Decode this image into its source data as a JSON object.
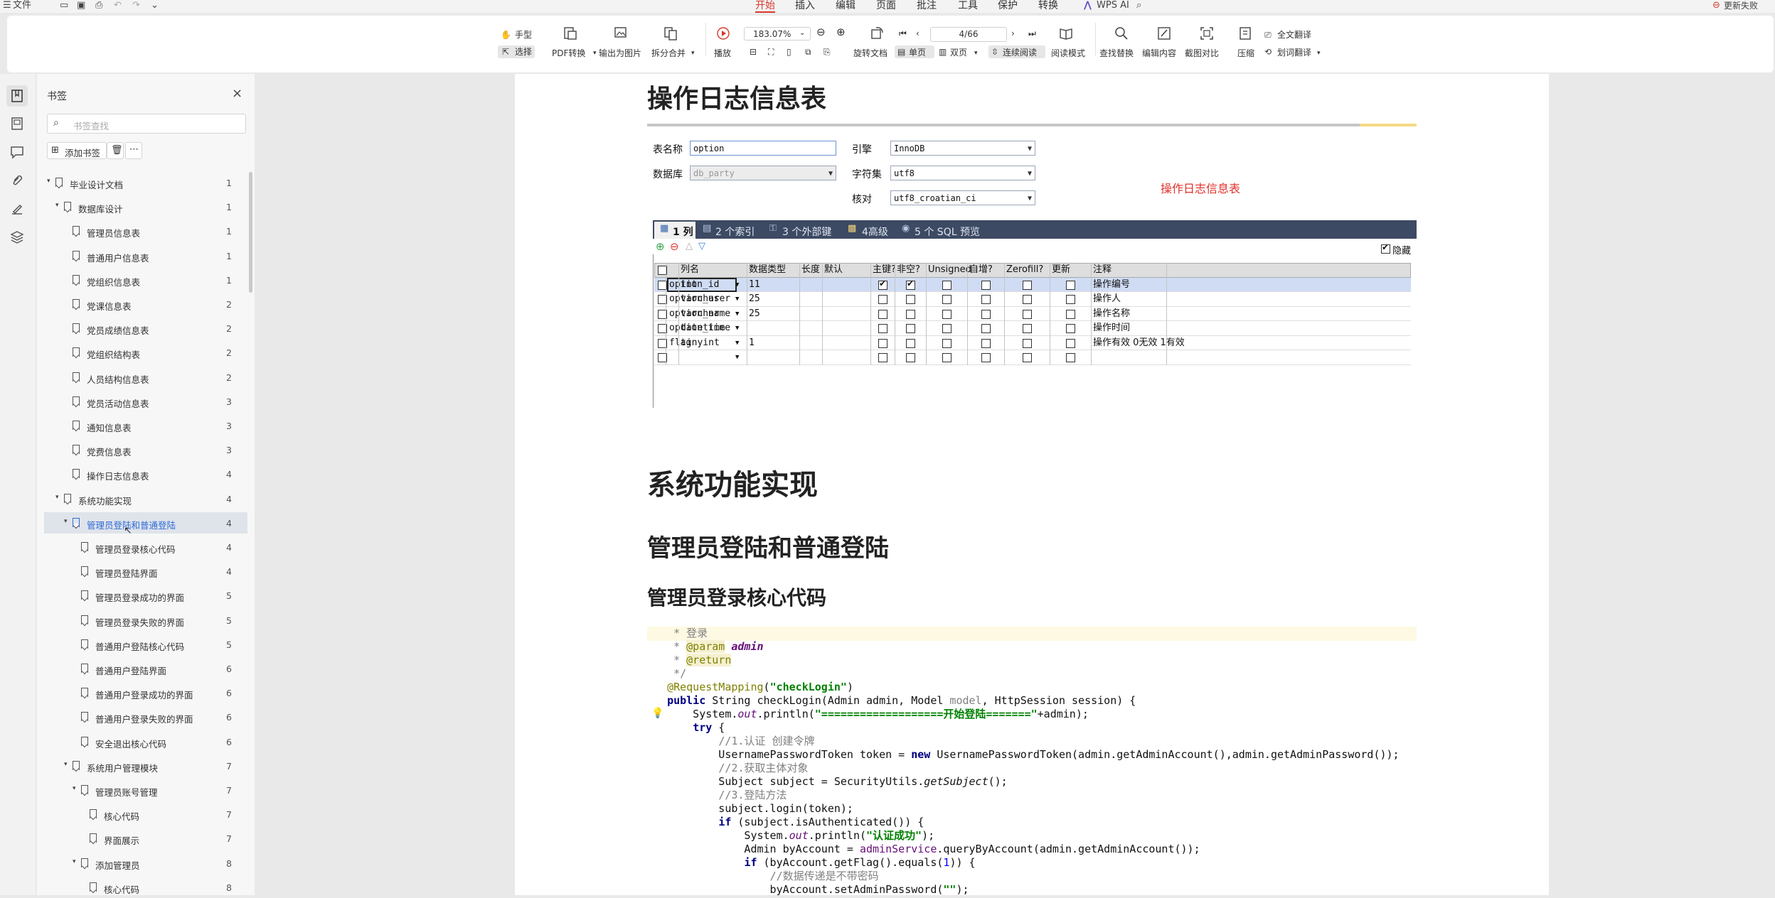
{
  "menubar": {
    "app_menu": "文件",
    "tabs": [
      "开始",
      "插入",
      "编辑",
      "页面",
      "批注",
      "工具",
      "保护",
      "转换"
    ],
    "active_tab": "开始",
    "wps_ai": "WPS AI",
    "status": "更新失败"
  },
  "toolbar": {
    "hand": "手型",
    "select": "选择",
    "pdf_convert": "PDF转换",
    "export_image": "输出为图片",
    "split_merge": "拆分合并",
    "play": "播放",
    "zoom": "183.07%",
    "page_indicator": "4/66",
    "rotate": "旋转文档",
    "single_page": "单页",
    "double_page": "双页",
    "continuous": "连续阅读",
    "read_mode": "阅读模式",
    "find_replace": "查找替换",
    "edit_content": "编辑内容",
    "screenshot_compare": "截图对比",
    "compress": "压缩",
    "full_translate": "全文翻译",
    "word_translate": "划词翻译"
  },
  "bookmarks": {
    "title": "书签",
    "search_placeholder": "书签查找",
    "add_label": "添加书签",
    "items": [
      {
        "label": "毕业设计文档",
        "page": "1"
      },
      {
        "label": "数据库设计",
        "page": "1"
      },
      {
        "label": "管理员信息表",
        "page": "1"
      },
      {
        "label": "普通用户信息表",
        "page": "1"
      },
      {
        "label": "党组织信息表",
        "page": "1"
      },
      {
        "label": "党课信息表",
        "page": "2"
      },
      {
        "label": "党员成绩信息表",
        "page": "2"
      },
      {
        "label": "党组织结构表",
        "page": "2"
      },
      {
        "label": "人员结构信息表",
        "page": "2"
      },
      {
        "label": "党员活动信息表",
        "page": "3"
      },
      {
        "label": "通知信息表",
        "page": "3"
      },
      {
        "label": "党费信息表",
        "page": "3"
      },
      {
        "label": "操作日志信息表",
        "page": "4"
      },
      {
        "label": "系统功能实现",
        "page": "4"
      },
      {
        "label": "管理员登陆和普通登陆",
        "page": "4"
      },
      {
        "label": "管理员登录核心代码",
        "page": "4"
      },
      {
        "label": "管理员登陆界面",
        "page": "4"
      },
      {
        "label": "管理员登录成功的界面",
        "page": "5"
      },
      {
        "label": "管理员登录失败的界面",
        "page": "5"
      },
      {
        "label": "普通用户登陆核心代码",
        "page": "5"
      },
      {
        "label": "普通用户登陆界面",
        "page": "6"
      },
      {
        "label": "普通用户登录成功的界面",
        "page": "6"
      },
      {
        "label": "普通用户登录失败的界面",
        "page": "6"
      },
      {
        "label": "安全退出核心代码",
        "page": "6"
      },
      {
        "label": "系统用户管理模块",
        "page": "7"
      },
      {
        "label": "管理员账号管理",
        "page": "7"
      },
      {
        "label": "核心代码",
        "page": "7"
      },
      {
        "label": "界面展示",
        "page": "7"
      },
      {
        "label": "添加管理员",
        "page": "8"
      },
      {
        "label": "核心代码",
        "page": "8"
      }
    ]
  },
  "document": {
    "heading_log_table": "操作日志信息表",
    "form": {
      "table_name_label": "表名称",
      "table_name_value": "option",
      "database_label": "数据库",
      "database_value": "db_party",
      "engine_label": "引擎",
      "engine_value": "InnoDB",
      "charset_label": "字符集",
      "charset_value": "utf8",
      "collation_label": "核对",
      "collation_value": "utf8_croatian_ci",
      "caption": "操作日志信息表"
    },
    "grid": {
      "tabs": [
        "1 列",
        "2 个索引",
        "3 个外部键",
        "4高级",
        "5 个 SQL 预览"
      ],
      "hide_label": "隐藏",
      "headers": [
        "列名",
        "数据类型",
        "长度",
        "默认",
        "主键?",
        "非空?",
        "Unsigned",
        "自增?",
        "Zerofill?",
        "更新",
        "注释"
      ],
      "rows": [
        {
          "name": "option_id",
          "type": "int",
          "length": "11",
          "pk": true,
          "nn": true,
          "comment": "操作编号"
        },
        {
          "name": "option_user",
          "type": "varchar",
          "length": "25",
          "pk": false,
          "nn": false,
          "comment": "操作人"
        },
        {
          "name": "option_name",
          "type": "varchar",
          "length": "25",
          "pk": false,
          "nn": false,
          "comment": "操作名称"
        },
        {
          "name": "option_time",
          "type": "datetime",
          "length": "",
          "pk": false,
          "nn": false,
          "comment": "操作时间"
        },
        {
          "name": "flag",
          "type": "tinyint",
          "length": "1",
          "pk": false,
          "nn": false,
          "comment": "操作有效 0无效 1有效"
        },
        {
          "name": "",
          "type": "",
          "length": "",
          "pk": false,
          "nn": false,
          "comment": ""
        }
      ]
    },
    "heading_impl": "系统功能实现",
    "heading_login": "管理员登陆和普通登陆",
    "heading_core": "管理员登录核心代码"
  }
}
